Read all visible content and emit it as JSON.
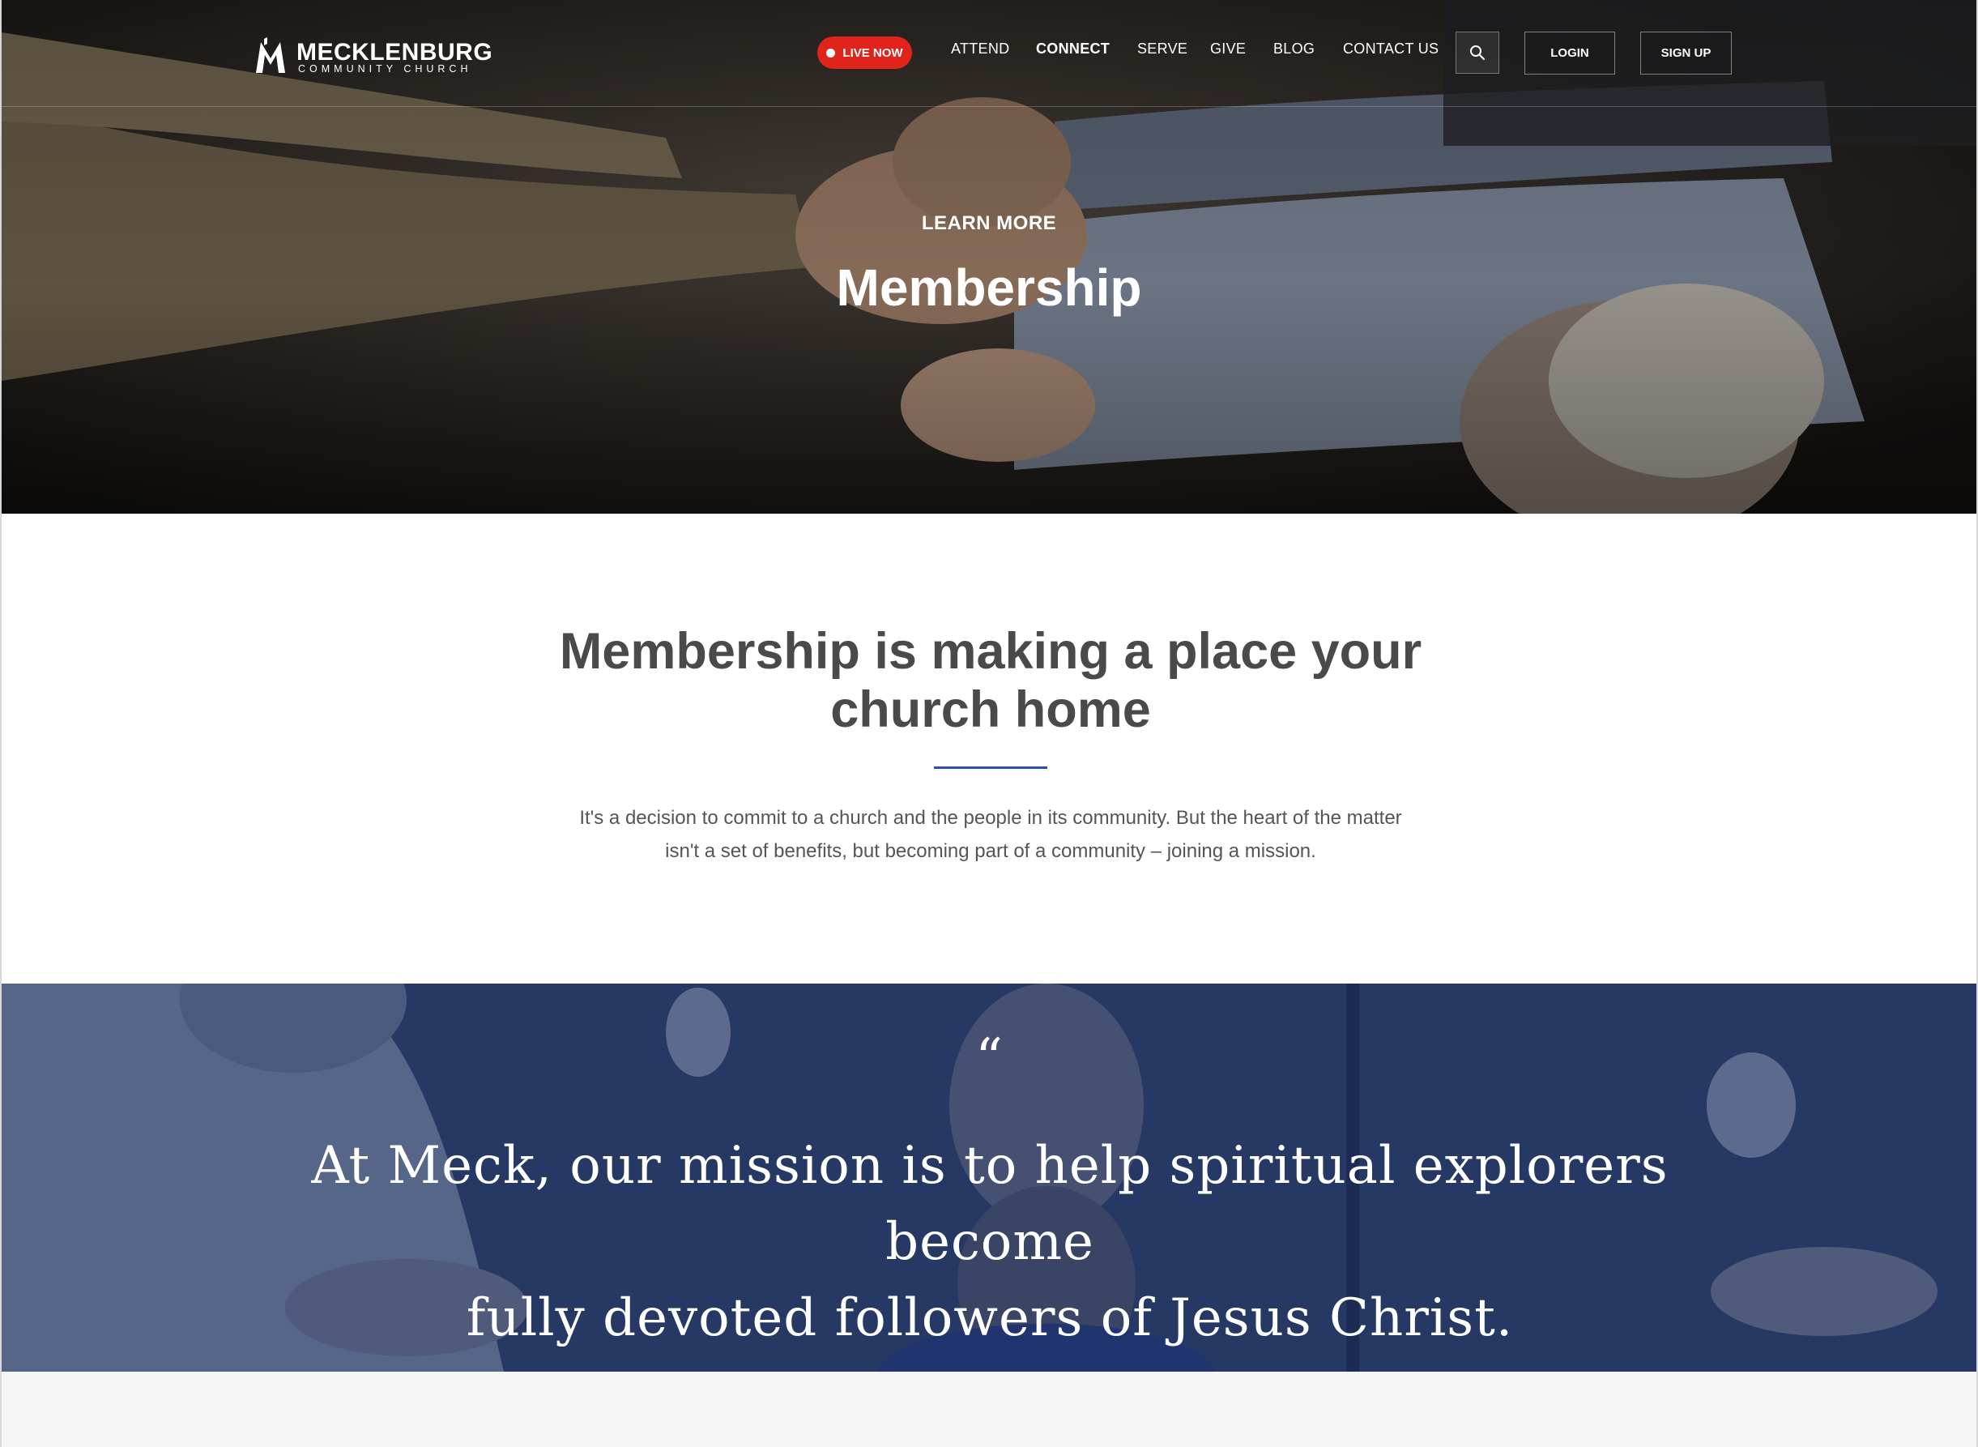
{
  "site": {
    "logo_name": "MECKLENBURG",
    "logo_sub": "COMMUNITY CHURCH"
  },
  "nav": {
    "live_label": "LIVE NOW",
    "items": [
      {
        "label": "ATTEND"
      },
      {
        "label": "CONNECT"
      },
      {
        "label": "SERVE"
      },
      {
        "label": "GIVE"
      },
      {
        "label": "BLOG"
      },
      {
        "label": "CONTACT US"
      }
    ],
    "active": "CONNECT",
    "login_label": "LOGIN",
    "signup_label": "SIGN UP"
  },
  "hero": {
    "eyebrow": "LEARN MORE",
    "title": "Membership"
  },
  "intro": {
    "heading_line1": "Membership is making a place your",
    "heading_line2": "church home",
    "text_line1": "It's a decision to commit to a church and the people in its community. But the heart of the matter",
    "text_line2": "isn't a set of benefits, but becoming part of a community – joining a mission."
  },
  "quote": {
    "mark": "“",
    "line1": "At Meck, our mission is to help spiritual explorers become",
    "line2": "fully devoted followers of Jesus Christ."
  },
  "colors": {
    "live_red": "#e0241b",
    "accent_blue": "#2c52a8",
    "heading_gray": "#4a4a4a",
    "quote_tint": "#1a2e60"
  }
}
